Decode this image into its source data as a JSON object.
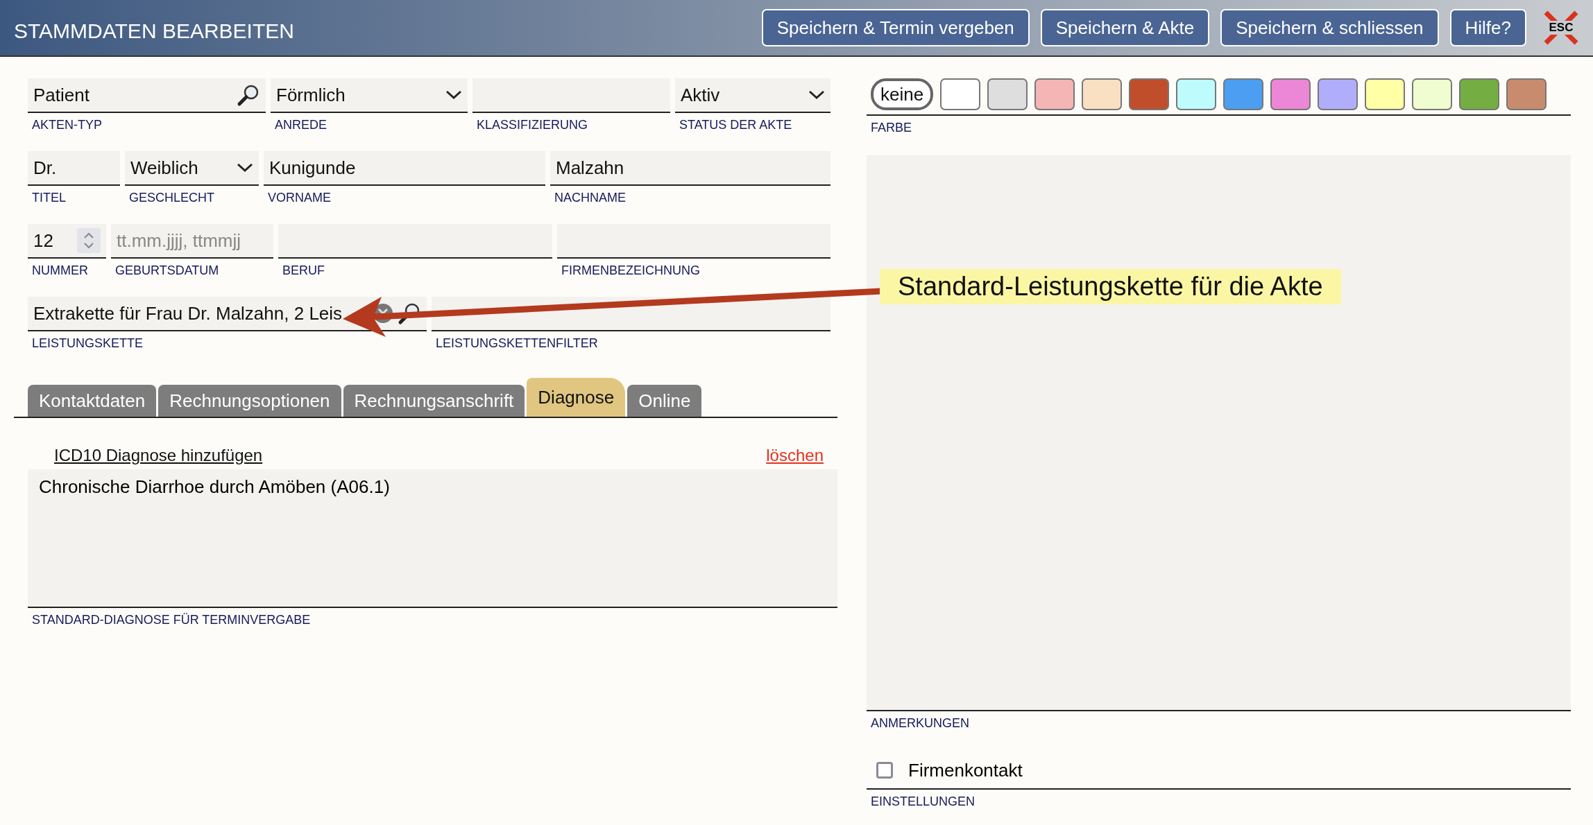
{
  "header": {
    "title": "STAMMDATEN BEARBEITEN",
    "buttons": [
      "Speichern & Termin vergeben",
      "Speichern & Akte",
      "Speichern & schliessen",
      "Hilfe?"
    ],
    "close_label": "ESC"
  },
  "form_rows": [
    {
      "fields": [
        {
          "kind": "lookup",
          "value": "Patient",
          "label": "AKTEN-TYP"
        },
        {
          "kind": "select",
          "value": "Förmlich",
          "label": "ANREDE"
        },
        {
          "kind": "text",
          "label": "KLASSIFIZIERUNG"
        },
        {
          "kind": "select",
          "value": "Aktiv",
          "label": "STATUS DER AKTE"
        }
      ]
    },
    {
      "fields": [
        {
          "kind": "text",
          "value": "Dr.",
          "label": "TITEL"
        },
        {
          "kind": "select",
          "value": "Weiblich",
          "label": "GESCHLECHT"
        },
        {
          "kind": "text",
          "value": "Kunigunde",
          "label": "VORNAME"
        },
        {
          "kind": "text",
          "value": "Malzahn",
          "label": "NACHNAME"
        }
      ]
    },
    {
      "fields": [
        {
          "kind": "spinner",
          "value": "12",
          "label": "NUMMER"
        },
        {
          "kind": "text",
          "placeholder": "tt.mm.jjjj, ttmmjj",
          "label": "GEBURTSDATUM"
        },
        {
          "kind": "text",
          "label": "BERUF"
        },
        {
          "kind": "text",
          "label": "FIRMENBEZEICHNUNG"
        }
      ]
    },
    {
      "fields": [
        {
          "kind": "clearable-lookup",
          "value": "Extrakette für Frau Dr. Malzahn, 2 Leis",
          "label": "LEISTUNGSKETTE"
        },
        {
          "kind": "text",
          "label": "LEISTUNGSKETTENFILTER"
        }
      ]
    }
  ],
  "tabs": [
    {
      "label": "Kontaktdaten",
      "selected": false
    },
    {
      "label": "Rechnungsoptionen",
      "selected": false
    },
    {
      "label": "Rechnungsanschrift",
      "selected": false
    },
    {
      "label": "Diagnose",
      "selected": true
    },
    {
      "label": "Online",
      "selected": false
    }
  ],
  "diagnosis": {
    "add_link": "ICD10 Diagnose hinzufügen",
    "delete_link": "löschen",
    "value": "Chronische Diarrhoe durch Amöben (A06.1)",
    "label": "STANDARD-DIAGNOSE FÜR TERMINVERGABE"
  },
  "colors": {
    "options": [
      {
        "kind": "none",
        "label": "keine",
        "selected": true
      },
      {
        "kind": "swatch",
        "color": "#ffffff",
        "selected": false
      },
      {
        "kind": "swatch",
        "color": "#dedede",
        "selected": false
      },
      {
        "kind": "swatch",
        "color": "#f5b5b5",
        "selected": false
      },
      {
        "kind": "swatch",
        "color": "#fae0c2",
        "selected": false
      },
      {
        "kind": "swatch",
        "color": "#c14e2b",
        "selected": false
      },
      {
        "kind": "swatch",
        "color": "#bdfbfd",
        "selected": false
      },
      {
        "kind": "swatch",
        "color": "#4b9ef2",
        "selected": false
      },
      {
        "kind": "swatch",
        "color": "#ec86d6",
        "selected": false
      },
      {
        "kind": "swatch",
        "color": "#b0aefb",
        "selected": false
      },
      {
        "kind": "swatch",
        "color": "#ffffa6",
        "selected": false
      },
      {
        "kind": "swatch",
        "color": "#f0fdd0",
        "selected": false
      },
      {
        "kind": "swatch",
        "color": "#74ad41",
        "selected": false
      },
      {
        "kind": "swatch",
        "color": "#c98b6e",
        "selected": false
      }
    ],
    "label": "FARBE"
  },
  "notes": {
    "label": "ANMERKUNGEN"
  },
  "settings": {
    "checkbox": {
      "label": "Firmenkontakt",
      "checked": false
    },
    "label": "EINSTELLUNGEN"
  },
  "annotation": {
    "text": "Standard-Leistungskette für die Akte"
  }
}
